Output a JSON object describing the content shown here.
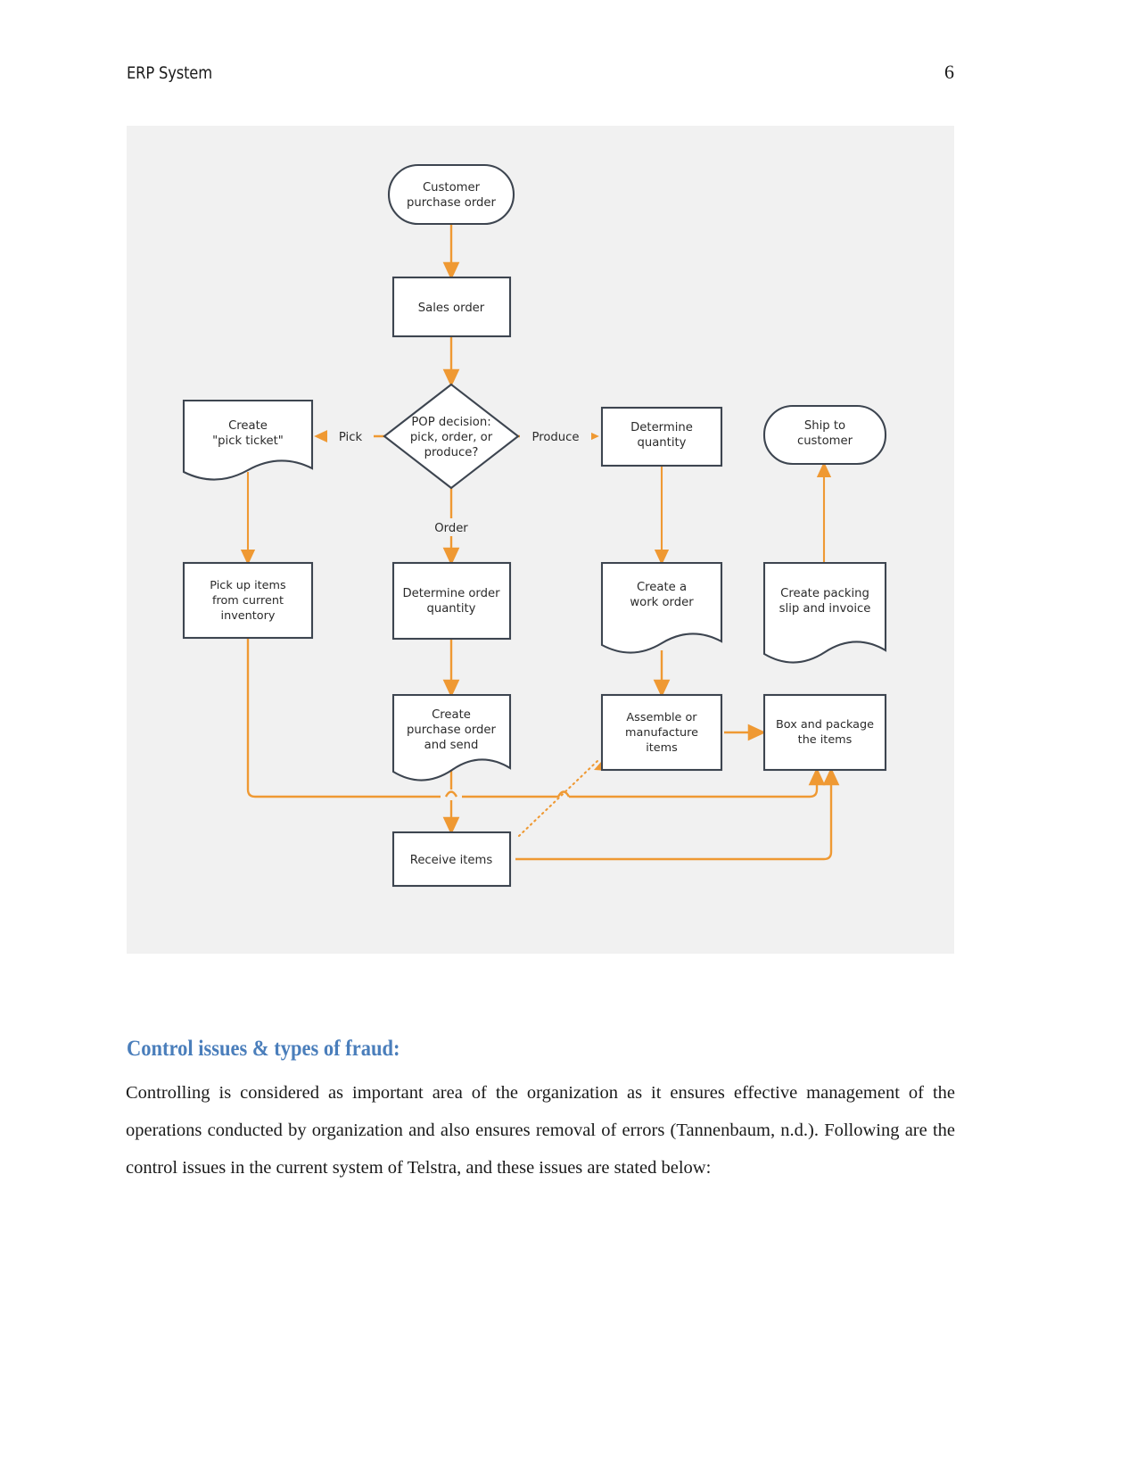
{
  "header": {
    "title": "ERP System",
    "page_number": "6"
  },
  "figure": {
    "background_color": "#f1f1f1",
    "connector_color": "#ef9933",
    "shape_border_color": "#3d4550",
    "nodes": {
      "customer_purchase_order": "Customer\npurchase order",
      "customer_purchase_order_l1": "Customer",
      "customer_purchase_order_l2": "purchase order",
      "sales_order": "Sales order",
      "pop_decision_l1": "POP decision:",
      "pop_decision_l2": "pick, order, or",
      "pop_decision_l3": "produce?",
      "create_pick_ticket_l1": "Create",
      "create_pick_ticket_l2": "\"pick ticket\"",
      "determine_quantity_l1": "Determine",
      "determine_quantity_l2": "quantity",
      "ship_to_customer_l1": "Ship to",
      "ship_to_customer_l2": "customer",
      "pick_up_items_l1": "Pick up items",
      "pick_up_items_l2": "from current",
      "pick_up_items_l3": "inventory",
      "determine_order_quantity_l1": "Determine order",
      "determine_order_quantity_l2": "quantity",
      "create_work_order_l1": "Create a",
      "create_work_order_l2": "work order",
      "create_packing_slip_l1": "Create packing",
      "create_packing_slip_l2": "slip and invoice",
      "create_purchase_order_l1": "Create",
      "create_purchase_order_l2": "purchase order",
      "create_purchase_order_l3": "and send",
      "assemble_items_l1": "Assemble or",
      "assemble_items_l2": "manufacture",
      "assemble_items_l3": "items",
      "box_package_l1": "Box and package",
      "box_package_l2": "the items",
      "receive_items": "Receive items"
    },
    "edge_labels": {
      "pick": "Pick",
      "produce": "Produce",
      "order": "Order"
    }
  },
  "content": {
    "heading": "Control issues & types of fraud:",
    "heading_color": "#4a7ebb",
    "paragraph": "Controlling is considered as important area of the organization as it ensures effective management of the operations conducted by organization and also ensures removal of errors (Tannenbaum, n.d.). Following are the control issues in the current system of Telstra, and these issues are stated below:"
  }
}
